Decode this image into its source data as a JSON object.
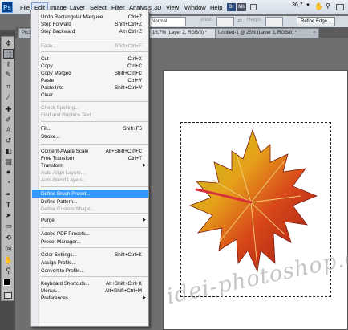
{
  "app": {
    "logo": "Ps"
  },
  "menubar": {
    "file": "File",
    "edit": "Edit",
    "image": "Image",
    "layer": "Layer",
    "select": "Select",
    "filter": "Filter",
    "analysis": "Analysis",
    "three_d": "3D",
    "view": "View",
    "window": "Window",
    "help": "Help",
    "zoom": "36,7"
  },
  "options": {
    "style_value": "Normal",
    "width_label": "Width:",
    "height_label": "Height:",
    "refine_edge": "Refine Edge..."
  },
  "tabs": [
    {
      "label": "Pic3",
      "active": false
    },
    {
      "label": "16,7% (Layer 2, RGB/8) *",
      "active": true
    },
    {
      "label": "Untitled-1 @ 25% (Layer 3, RGB/8) *",
      "active": false
    }
  ],
  "edit_menu": {
    "items": [
      {
        "label": "Undo Rectangular Marquee",
        "shortcut": "Ctrl+Z",
        "disabled": false
      },
      {
        "label": "Step Forward",
        "shortcut": "Shift+Ctrl+Z",
        "disabled": false
      },
      {
        "label": "Step Backward",
        "shortcut": "Alt+Ctrl+Z",
        "disabled": false
      },
      {
        "label": "Fade...",
        "shortcut": "Shift+Ctrl+F",
        "disabled": true
      },
      {
        "label": "Cut",
        "shortcut": "Ctrl+X",
        "disabled": false
      },
      {
        "label": "Copy",
        "shortcut": "Ctrl+C",
        "disabled": false
      },
      {
        "label": "Copy Merged",
        "shortcut": "Shift+Ctrl+C",
        "disabled": false
      },
      {
        "label": "Paste",
        "shortcut": "Ctrl+V",
        "disabled": false
      },
      {
        "label": "Paste Into",
        "shortcut": "Shift+Ctrl+V",
        "disabled": false
      },
      {
        "label": "Clear",
        "shortcut": "",
        "disabled": false
      },
      {
        "label": "Check Spelling...",
        "shortcut": "",
        "disabled": true
      },
      {
        "label": "Find and Replace Text...",
        "shortcut": "",
        "disabled": true
      },
      {
        "label": "Fill...",
        "shortcut": "Shift+F5",
        "disabled": false
      },
      {
        "label": "Stroke...",
        "shortcut": "",
        "disabled": false
      },
      {
        "label": "Content-Aware Scale",
        "shortcut": "Alt+Shift+Ctrl+C",
        "disabled": false
      },
      {
        "label": "Free Transform",
        "shortcut": "Ctrl+T",
        "disabled": false
      },
      {
        "label": "Transform",
        "shortcut": "",
        "disabled": false,
        "submenu": true
      },
      {
        "label": "Auto-Align Layers...",
        "shortcut": "",
        "disabled": true
      },
      {
        "label": "Auto-Blend Layers...",
        "shortcut": "",
        "disabled": true
      },
      {
        "label": "Define Brush Preset...",
        "shortcut": "",
        "disabled": false,
        "highlighted": true
      },
      {
        "label": "Define Pattern...",
        "shortcut": "",
        "disabled": false
      },
      {
        "label": "Define Custom Shape...",
        "shortcut": "",
        "disabled": true
      },
      {
        "label": "Purge",
        "shortcut": "",
        "disabled": false,
        "submenu": true
      },
      {
        "label": "Adobe PDF Presets...",
        "shortcut": "",
        "disabled": false
      },
      {
        "label": "Preset Manager...",
        "shortcut": "",
        "disabled": false
      },
      {
        "label": "Color Settings...",
        "shortcut": "Shift+Ctrl+K",
        "disabled": false
      },
      {
        "label": "Assign Profile...",
        "shortcut": "",
        "disabled": false
      },
      {
        "label": "Convert to Profile...",
        "shortcut": "",
        "disabled": false
      },
      {
        "label": "Keyboard Shortcuts...",
        "shortcut": "Alt+Shift+Ctrl+K",
        "disabled": false
      },
      {
        "label": "Menus...",
        "shortcut": "Alt+Shift+Ctrl+M",
        "disabled": false
      },
      {
        "label": "Preferences",
        "shortcut": "",
        "disabled": false,
        "submenu": true
      }
    ]
  },
  "watermark": {
    "text": "idei-photoshop.com"
  },
  "colors": {
    "highlight": "#3399ff",
    "menu_bg": "#f5f5f5",
    "workspace": "#6f6f6f"
  },
  "icons": {
    "tools": [
      "move-tool-icon",
      "marquee-tool-icon",
      "lasso-tool-icon",
      "quick-select-tool-icon",
      "crop-tool-icon",
      "eyedropper-tool-icon",
      "healing-tool-icon",
      "brush-tool-icon",
      "clone-stamp-tool-icon",
      "history-brush-tool-icon",
      "eraser-tool-icon",
      "gradient-tool-icon",
      "blur-tool-icon",
      "dodge-tool-icon",
      "pen-tool-icon",
      "type-tool-icon",
      "path-select-tool-icon",
      "shape-tool-icon",
      "3d-rotate-tool-icon",
      "3d-orbit-tool-icon",
      "hand-tool-icon",
      "zoom-tool-icon"
    ]
  }
}
